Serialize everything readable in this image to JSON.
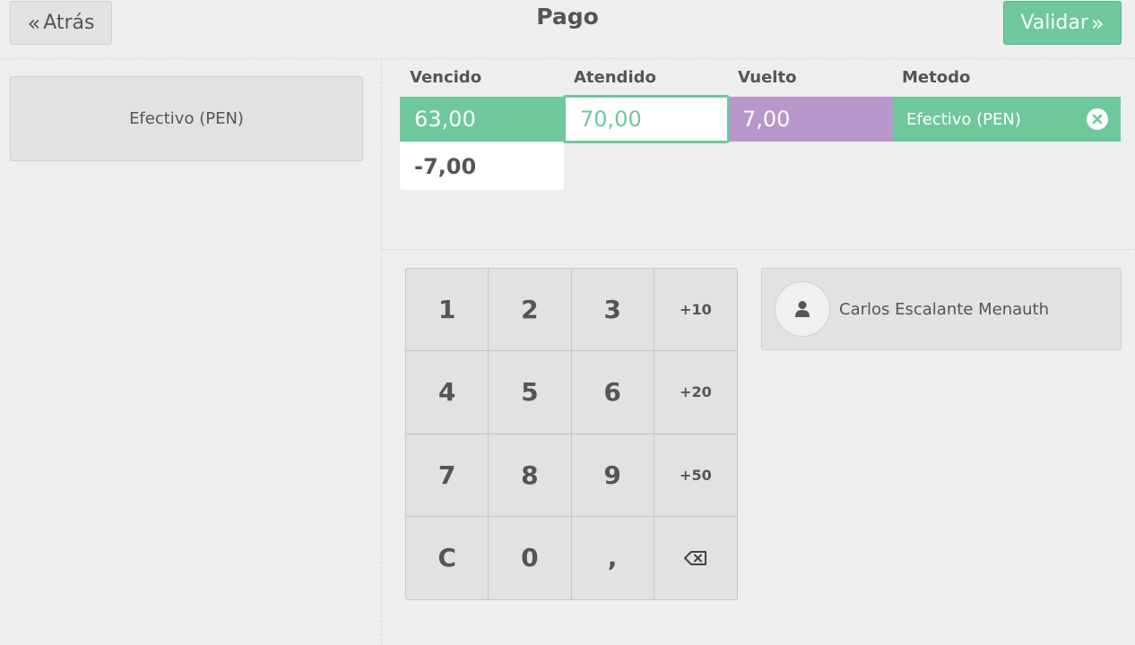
{
  "header": {
    "back_label": "Atrás",
    "back_icon": "double-chevron-left-icon",
    "title": "Pago",
    "validate_label": "Validar",
    "validate_icon": "double-chevron-right-icon"
  },
  "payment_methods": [
    {
      "label": "Efectivo (PEN)"
    }
  ],
  "paylines": {
    "columns": [
      "Vencido",
      "Atendido",
      "Vuelto",
      "Metodo"
    ],
    "line": {
      "due": "63,00",
      "tendered": "70,00",
      "change": "7,00",
      "method": "Efectivo (PEN)"
    },
    "remaining": "-7,00"
  },
  "numpad": {
    "keys": [
      "1",
      "2",
      "3",
      "+10",
      "4",
      "5",
      "6",
      "+20",
      "7",
      "8",
      "9",
      "+50",
      "C",
      "0",
      ",",
      "backspace-icon"
    ]
  },
  "customer": {
    "name": "Carlos Escalante Menauth",
    "icon": "user-icon"
  },
  "colors": {
    "accent": "#6ec89b",
    "change": "#b797cc",
    "background": "#efeeee",
    "button": "#e2e2e2"
  }
}
